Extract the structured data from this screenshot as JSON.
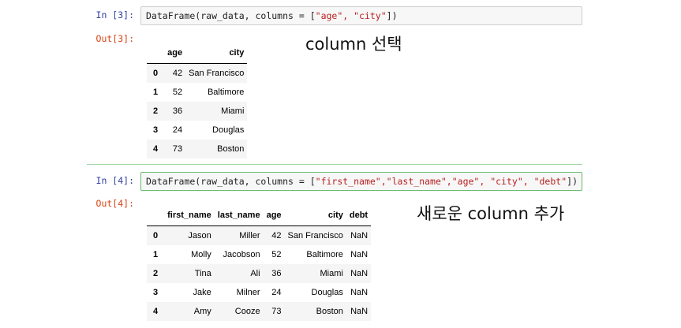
{
  "cell1": {
    "in_prompt": "In [3]:",
    "out_prompt": "Out[3]:",
    "code_prefix": "DataFrame(raw_data, columns = [",
    "code_args": "\"age\", \"city\"",
    "code_suffix": "])",
    "annotation": "column 선택",
    "table": {
      "columns": [
        "age",
        "city"
      ],
      "rows": [
        {
          "index": "0",
          "cells": [
            "42",
            "San Francisco"
          ]
        },
        {
          "index": "1",
          "cells": [
            "52",
            "Baltimore"
          ]
        },
        {
          "index": "2",
          "cells": [
            "36",
            "Miami"
          ]
        },
        {
          "index": "3",
          "cells": [
            "24",
            "Douglas"
          ]
        },
        {
          "index": "4",
          "cells": [
            "73",
            "Boston"
          ]
        }
      ]
    }
  },
  "cell2": {
    "in_prompt": "In [4]:",
    "out_prompt": "Out[4]:",
    "code_prefix": "DataFrame(raw_data, columns = [",
    "code_args": "\"first_name\",\"last_name\",\"age\", \"city\", \"debt\"",
    "code_suffix": "])",
    "annotation": "새로운 column 추가",
    "table": {
      "columns": [
        "first_name",
        "last_name",
        "age",
        "city",
        "debt"
      ],
      "rows": [
        {
          "index": "0",
          "cells": [
            "Jason",
            "Miller",
            "42",
            "San Francisco",
            "NaN"
          ]
        },
        {
          "index": "1",
          "cells": [
            "Molly",
            "Jacobson",
            "52",
            "Baltimore",
            "NaN"
          ]
        },
        {
          "index": "2",
          "cells": [
            "Tina",
            "Ali",
            "36",
            "Miami",
            "NaN"
          ]
        },
        {
          "index": "3",
          "cells": [
            "Jake",
            "Milner",
            "24",
            "Douglas",
            "NaN"
          ]
        },
        {
          "index": "4",
          "cells": [
            "Amy",
            "Cooze",
            "73",
            "Boston",
            "NaN"
          ]
        }
      ]
    }
  }
}
